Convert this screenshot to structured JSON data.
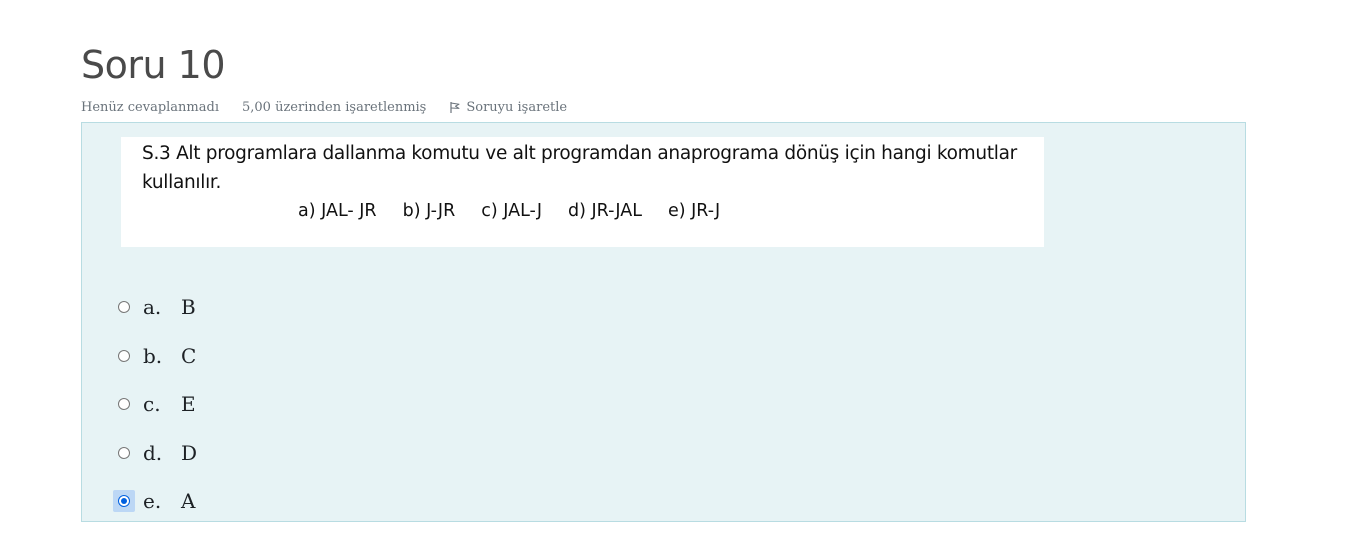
{
  "question": {
    "title": "Soru 10",
    "state": "Henüz cevaplanmadı",
    "grade": "5,00 üzerinden işaretlenmiş",
    "flag_label": "Soruyu işaretle"
  },
  "question_image": {
    "line1": "S.3 Alt programlara dallanma komutu ve alt programdan anaprograma dönüş için hangi komutlar",
    "line2": "kullanılır.",
    "options": [
      "a) JAL- JR",
      "b) J-JR",
      "c) JAL-J",
      "d) JR-JAL",
      "e) JR-J"
    ]
  },
  "answers": [
    {
      "number": "a.",
      "text": "B",
      "checked": false
    },
    {
      "number": "b.",
      "text": "C",
      "checked": false
    },
    {
      "number": "c.",
      "text": "E",
      "checked": false
    },
    {
      "number": "d.",
      "text": "D",
      "checked": false
    },
    {
      "number": "e.",
      "text": "A",
      "checked": true
    }
  ],
  "colors": {
    "formulation_bg": "#e7f3f5",
    "formulation_border": "#b8dce2",
    "radio_accent": "#0060df"
  },
  "icons": {
    "flag": "flag-icon"
  }
}
